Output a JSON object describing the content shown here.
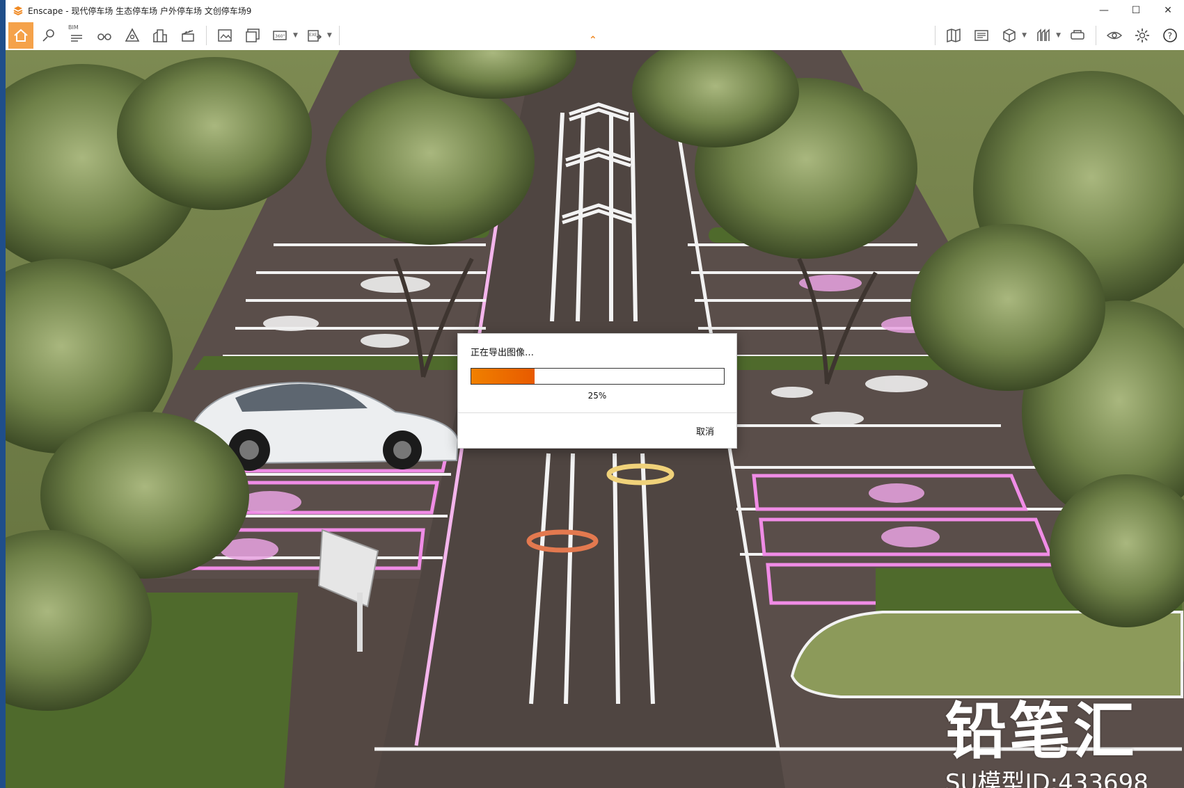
{
  "window": {
    "app_name": "Enscape",
    "title": "Enscape - 现代停车场 生态停车场 户外停车场 文创停车场9",
    "controls": {
      "minimize": "—",
      "maximize": "☐",
      "close": "✕"
    }
  },
  "toolbar": {
    "bim_label": "BIM",
    "accent": "#f5a24a",
    "collapse_glyph": "⌃"
  },
  "dialog": {
    "title": "正在导出图像…",
    "progress_percent": 25,
    "progress_text": "25%",
    "cancel_label": "取消"
  },
  "watermark": {
    "title": "铅笔汇",
    "subtitle": "SU模型ID:433698"
  }
}
